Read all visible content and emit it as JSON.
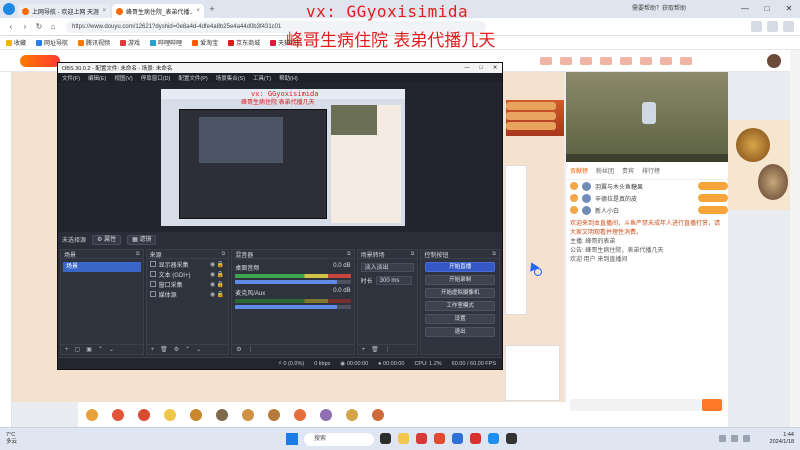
{
  "overlay": {
    "contact": "vx: GGyoxisimida",
    "slogan": "峰哥生病住院 表弟代播几天"
  },
  "browser": {
    "tabs": [
      {
        "label": "上网导航 - 欢迎上网 天涯浏览"
      },
      {
        "label": "峰哥生病住院_表弟代播..."
      }
    ],
    "url": "https://www.douyu.com/12621?dyshid=0e8a4d-4dfe4a8b25e4a44d0b3f431c01",
    "bookmarks": [
      "收藏",
      "网址导航",
      "腾讯视频",
      "游戏",
      "哔哩哔哩",
      "爱淘宝",
      "京东商城",
      "天猫精选"
    ],
    "promo": "需要帮助？获取帮助"
  },
  "obs": {
    "window_title": "OBS 30.0.2 - 配置文件: 未命名 - 场景: 未命名",
    "menu": [
      "文件(F)",
      "编辑(E)",
      "视图(V)",
      "停靠窗口(D)",
      "配置文件(P)",
      "场景集合(S)",
      "工具(T)",
      "帮助(H)"
    ],
    "no_source_label": "未选择源",
    "properties_btn": "属性",
    "filters_btn": "滤镜",
    "docks": {
      "scenes": {
        "title": "场景",
        "items": [
          "场景"
        ]
      },
      "sources": {
        "title": "来源",
        "items": [
          "显示器采集",
          "文本 (GDI+)",
          "窗口采集",
          "媒体源"
        ]
      },
      "mixer": {
        "title": "混音器",
        "tracks": [
          {
            "name": "桌面音频",
            "db": "0.0 dB"
          },
          {
            "name": "麦克风/Aux",
            "db": "0.0 dB"
          }
        ]
      },
      "transitions": {
        "title": "场景转场",
        "type": "淡入淡出",
        "duration_label": "时长",
        "duration": "300 ms"
      },
      "controls": {
        "title": "控制按钮",
        "buttons": [
          "开始直播",
          "开始录制",
          "开始虚拟摄像机",
          "工作室模式",
          "设置",
          "退出"
        ]
      }
    },
    "status": {
      "dropped": "0 (0.0%)",
      "bitrate": "0 kbps",
      "stream_time": "00:00:00",
      "rec_time": "00:00:00",
      "cpu": "CPU: 1.2%",
      "fps": "60.00 / 60.00 FPS"
    }
  },
  "site": {
    "side_tabs": [
      "贡献榜",
      "粉丝团",
      "贵宾",
      "排行榜"
    ],
    "rank": [
      {
        "name": "羽翼与木头鱼糖果"
      },
      {
        "name": "辛德拉是真的皮"
      },
      {
        "name": "新人小白"
      }
    ],
    "chat": [
      {
        "text": "欢迎来到本直播间，斗鱼严禁未成年人进行直播打赏，请大家文明观看并理性消费。",
        "warn": true
      },
      {
        "text": "主播: 峰哥的表弟",
        "warn": false
      },
      {
        "text": "公告: 峰哥生病住院，表弟代播几天",
        "warn": false
      },
      {
        "text": "欢迎 用户 来到直播间",
        "warn": false
      }
    ],
    "chat_send": "发送"
  },
  "taskbar": {
    "weather_temp": "7°C",
    "weather_desc": "多云",
    "search": "搜索",
    "time": "1:44",
    "date": "2024/1/18"
  }
}
